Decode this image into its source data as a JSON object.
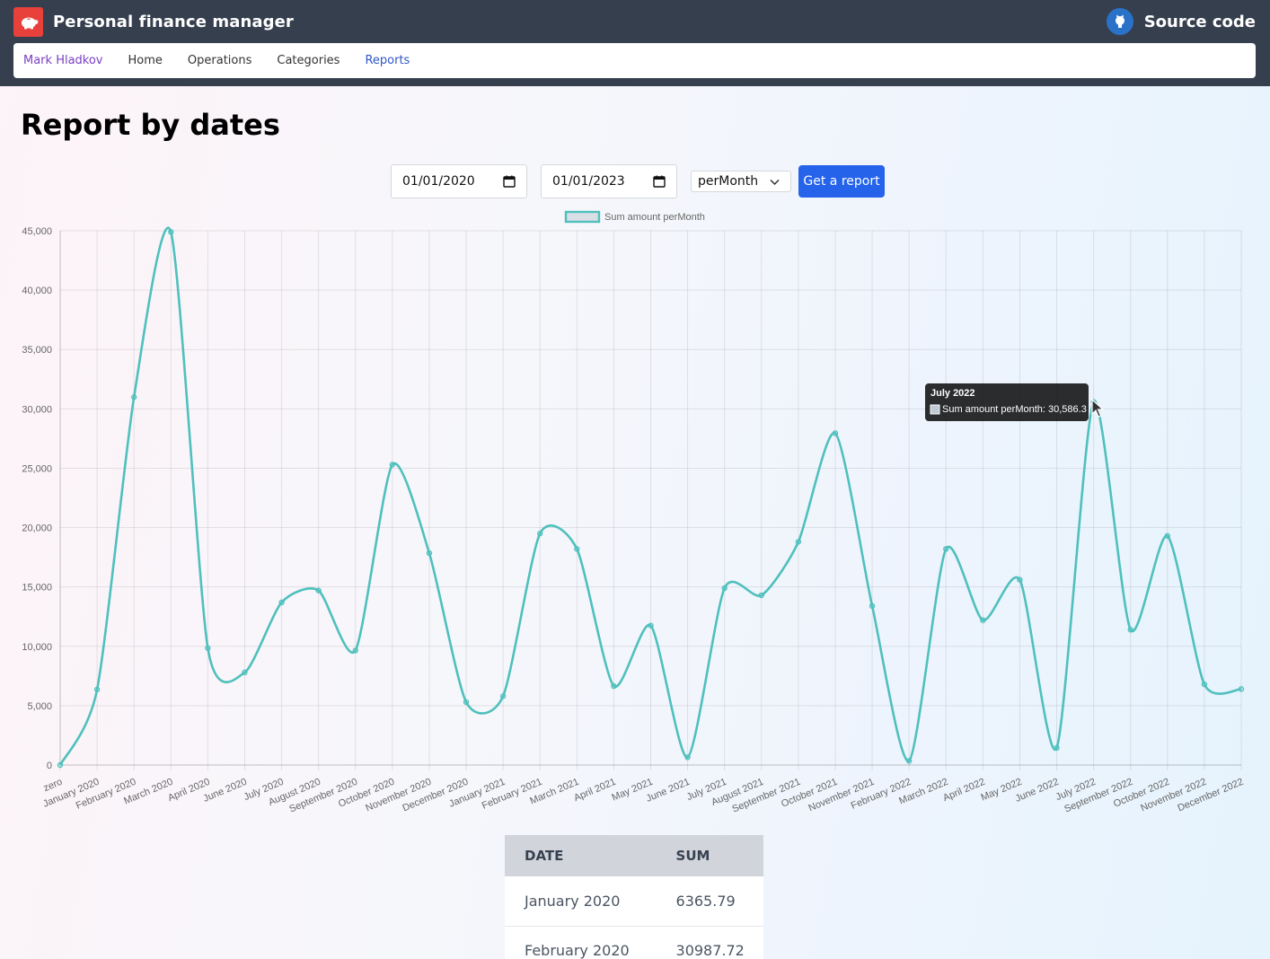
{
  "header": {
    "app_title": "Personal finance manager",
    "source_label": "Source code",
    "logo_icon": "piggy-bank-icon",
    "source_icon": "github-icon"
  },
  "nav": {
    "user": "Mark Hladkov",
    "items": [
      "Home",
      "Operations",
      "Categories",
      "Reports"
    ],
    "active": "Reports"
  },
  "page": {
    "title": "Report by dates"
  },
  "controls": {
    "start_date": "01/01/2020",
    "end_date": "01/01/2023",
    "period": "perMonth",
    "submit_label": "Get a report"
  },
  "tooltip": {
    "title": "July 2022",
    "label": "Sum amount perMonth: 30,586.3"
  },
  "colors": {
    "line": "#4fc0bd",
    "accent": "#2563eb",
    "header": "#363f4e"
  },
  "chart_data": {
    "type": "line",
    "legend_position": "top",
    "grid": true,
    "ylim": [
      0,
      45000
    ],
    "yticks": [
      "0",
      "5,000",
      "10,000",
      "15,000",
      "20,000",
      "25,000",
      "30,000",
      "35,000",
      "40,000",
      "45,000"
    ],
    "categories": [
      "zero",
      "January 2020",
      "February 2020",
      "March 2020",
      "April 2020",
      "June 2020",
      "July 2020",
      "August 2020",
      "September 2020",
      "October 2020",
      "November 2020",
      "December 2020",
      "January 2021",
      "February 2021",
      "March 2021",
      "April 2021",
      "May 2021",
      "June 2021",
      "July 2021",
      "August 2021",
      "September 2021",
      "October 2021",
      "November 2021",
      "February 2022",
      "March 2022",
      "April 2022",
      "May 2022",
      "June 2022",
      "July 2022",
      "September 2022",
      "October 2022",
      "November 2022",
      "December 2022"
    ],
    "series": [
      {
        "name": "Sum amount perMonth",
        "values": [
          0,
          6365.79,
          30987.72,
          44900,
          9850,
          7800,
          13700,
          14700,
          9650,
          25300,
          17850,
          5300,
          5800,
          19500,
          18200,
          6650,
          11750,
          650,
          14900,
          14300,
          18800,
          27950,
          13400,
          350,
          18200,
          12200,
          15600,
          1450,
          30586.3,
          11400,
          19300,
          6800,
          6400
        ]
      }
    ]
  },
  "table": {
    "headers": [
      "DATE",
      "SUM"
    ],
    "rows": [
      [
        "January 2020",
        "6365.79"
      ],
      [
        "February 2020",
        "30987.72"
      ]
    ]
  }
}
